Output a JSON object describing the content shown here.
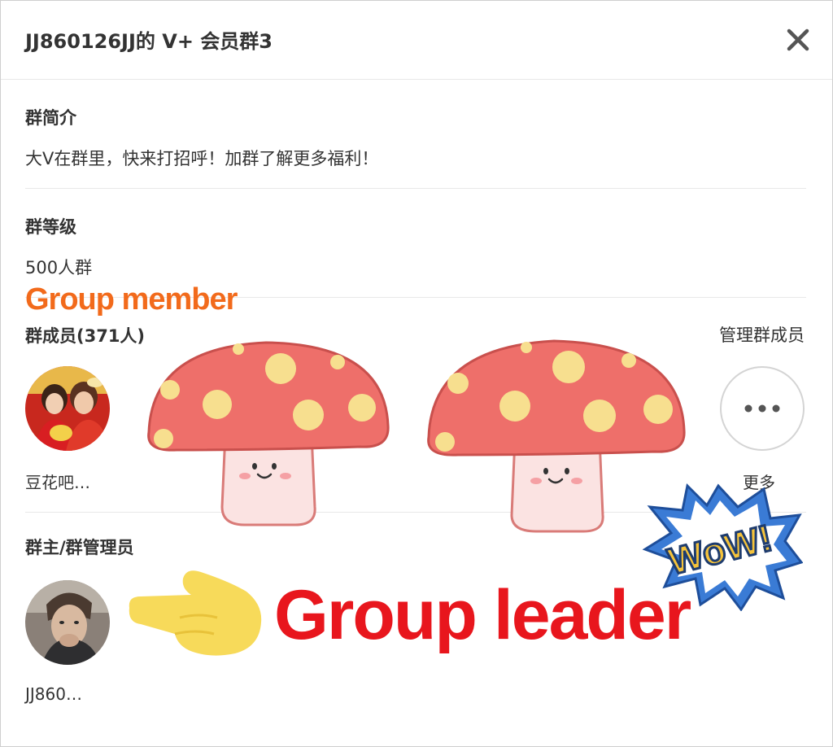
{
  "header": {
    "title": "JJ860126JJ的 V+ 会员群3",
    "close_icon": "close-icon"
  },
  "intro": {
    "label": "群简介",
    "text": "大V在群里，快来打招呼！加群了解更多福利！"
  },
  "level": {
    "label": "群等级",
    "text": "500人群"
  },
  "members": {
    "annotation": "Group member",
    "label": "群成员(371人)",
    "manage_label": "管理群成员",
    "items": [
      {
        "name": "豆花吧…"
      }
    ],
    "more_label": "更多",
    "more_icon": "ellipsis-icon"
  },
  "admins": {
    "label": "群主/群管理员",
    "items": [
      {
        "name": "JJ860…"
      }
    ],
    "annotation": "Group leader"
  },
  "stickers": {
    "wow_text": "WoW!"
  },
  "colors": {
    "annotation_orange": "#f26a1b",
    "annotation_red": "#e8161d",
    "mushroom_cap": "#ee6f6a",
    "mushroom_spot": "#f7df8f",
    "pointer_hand": "#f7da5a",
    "wow_blue": "#3a7bd5",
    "wow_yellow": "#f5c33b"
  }
}
